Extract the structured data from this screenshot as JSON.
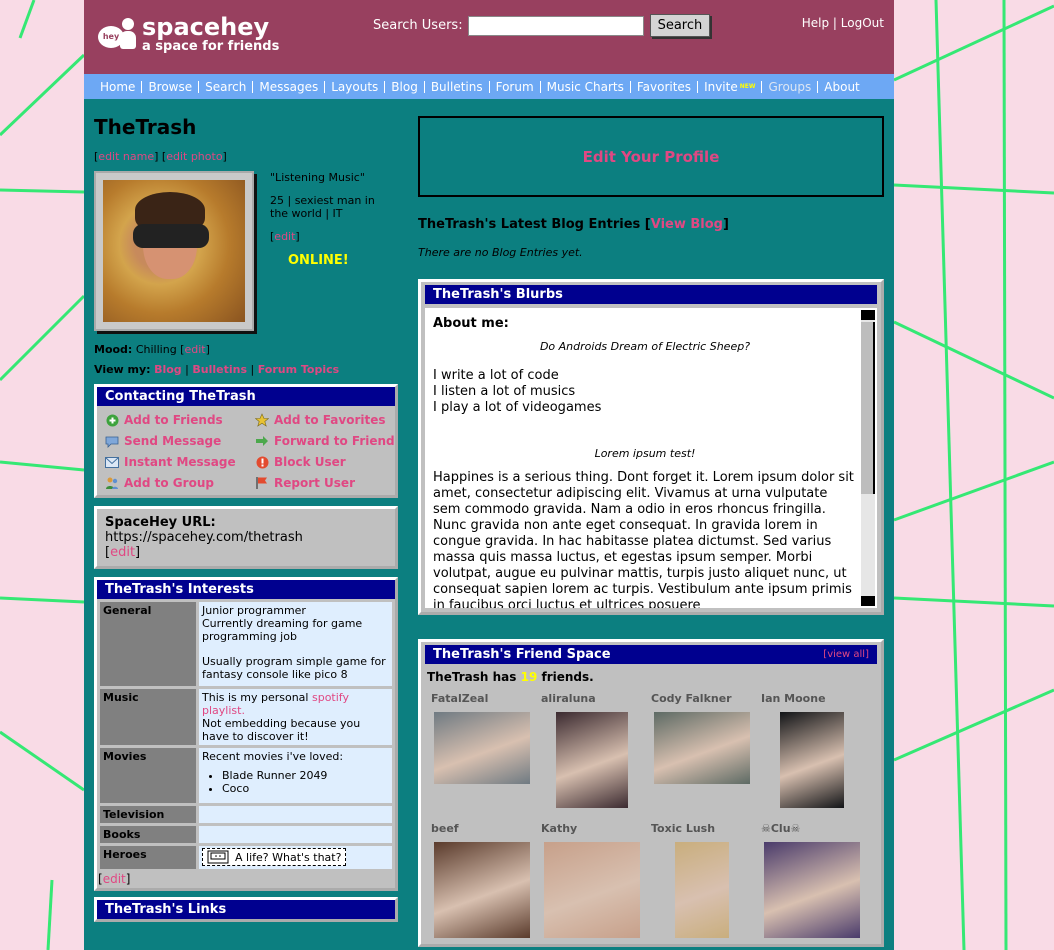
{
  "header": {
    "logo_name": "spacehey",
    "logo_tagline": "a space for friends",
    "logo_badge": "hey",
    "search_label": "Search Users:",
    "search_value": "",
    "search_button": "Search",
    "help": "Help",
    "separator": "|",
    "logout": "LogOut"
  },
  "nav": {
    "items": [
      "Home",
      "Browse",
      "Search",
      "Messages",
      "Layouts",
      "Blog",
      "Bulletins",
      "Forum",
      "Music Charts",
      "Favorites",
      "Invite",
      "Groups",
      "About"
    ],
    "new_badge": "NEW"
  },
  "profile": {
    "name": "TheTrash",
    "edit_name": "edit name",
    "edit_photo": "edit photo",
    "status_quote": "\"Listening Music\"",
    "details": "25 | sexiest man in the world | IT",
    "edit": "edit",
    "online": "ONLINE!",
    "mood_label": "Mood:",
    "mood_value": "Chilling",
    "viewmy_label": "View my:",
    "viewmy_blog": "Blog",
    "viewmy_bulletins": "Bulletins",
    "viewmy_forum": "Forum Topics"
  },
  "contacting": {
    "title": "Contacting TheTrash",
    "items": [
      {
        "label": "Add to Friends",
        "icon": "add-friend-icon"
      },
      {
        "label": "Add to Favorites",
        "icon": "favorites-icon"
      },
      {
        "label": "Send Message",
        "icon": "message-icon"
      },
      {
        "label": "Forward to Friend",
        "icon": "forward-icon"
      },
      {
        "label": "Instant Message",
        "icon": "instant-message-icon"
      },
      {
        "label": "Block User",
        "icon": "block-icon"
      },
      {
        "label": "Add to Group",
        "icon": "group-icon"
      },
      {
        "label": "Report User",
        "icon": "report-icon"
      }
    ]
  },
  "url_box": {
    "label": "SpaceHey URL:",
    "url": "https://spacehey.com/thetrash",
    "edit": "edit"
  },
  "interests": {
    "title": "TheTrash's Interests",
    "general_label": "General",
    "general_line1": "Junior programmer",
    "general_line2": "Currently dreaming for game programming job",
    "general_line3": "Usually program simple game for fantasy console like pico 8",
    "music_label": "Music",
    "music_prefix": "This is my personal",
    "music_link": "spotify playlist.",
    "music_suffix": "Not embedding because you have to discover it!",
    "movies_label": "Movies",
    "movies_intro": "Recent movies i've loved:",
    "movies_list": [
      "Blade Runner 2049",
      "Coco"
    ],
    "television_label": "Television",
    "books_label": "Books",
    "heroes_label": "Heroes",
    "heroes_value": "A life? What's that?",
    "edit": "edit"
  },
  "links_box": {
    "title": "TheTrash's Links"
  },
  "edit_profile": "Edit Your Profile",
  "blog": {
    "title_prefix": "TheTrash's Latest Blog Entries [",
    "view_blog": "View Blog",
    "title_suffix": "]",
    "empty": "There are no Blog Entries yet."
  },
  "blurbs": {
    "title": "TheTrash's Blurbs",
    "about_heading": "About me:",
    "quote": "Do Androids Dream of Electric Sheep?",
    "lines": [
      "I write a lot of code",
      "I listen a lot of musics",
      "I play a lot of videogames"
    ],
    "lorem_heading": "Lorem ipsum test!",
    "paragraph": "Happines is a serious thing. Dont forget it. Lorem ipsum dolor sit amet, consectetur adipiscing elit. Vivamus at urna vulputate sem commodo gravida. Nam a odio in eros rhoncus fringilla. Nunc gravida non ante eget consequat. In gravida lorem in congue gravida. In hac habitasse platea dictumst. Sed varius massa quis massa luctus, et egestas ipsum semper. Morbi volutpat, augue eu pulvinar mattis, turpis justo aliquet nunc, ut consequat sapien lorem ac turpis. Vestibulum ante ipsum primis in faucibus orci luctus et ultrices posuere"
  },
  "friends": {
    "title": "TheTrash's Friend Space",
    "view_all": "[view all]",
    "count_prefix": "TheTrash has",
    "count": "19",
    "count_suffix": "friends.",
    "list": [
      {
        "name": "FatalZeal",
        "color": "#6f7a82"
      },
      {
        "name": "aliraluna",
        "color": "#3b2a30"
      },
      {
        "name": "Cody Falkner",
        "color": "#5d6a64"
      },
      {
        "name": "Ian Moone",
        "color": "#121417"
      },
      {
        "name": "beef",
        "color": "#5a3b2c"
      },
      {
        "name": "Kathy",
        "color": "#c7a08a"
      },
      {
        "name": "Toxic Lush",
        "color": "#c9ae7d"
      },
      {
        "name": "☠Clu☠",
        "color": "#4a3b6b"
      }
    ]
  },
  "colors": {
    "page_bg": "#f9dbe6",
    "grid_lines": "#35e874",
    "header_bg": "#98405f",
    "nav_bg": "#6da8f4",
    "content_bg": "#0c7f80",
    "box_header": "#00008f",
    "link": "#e04883",
    "online": "#ffff00"
  }
}
